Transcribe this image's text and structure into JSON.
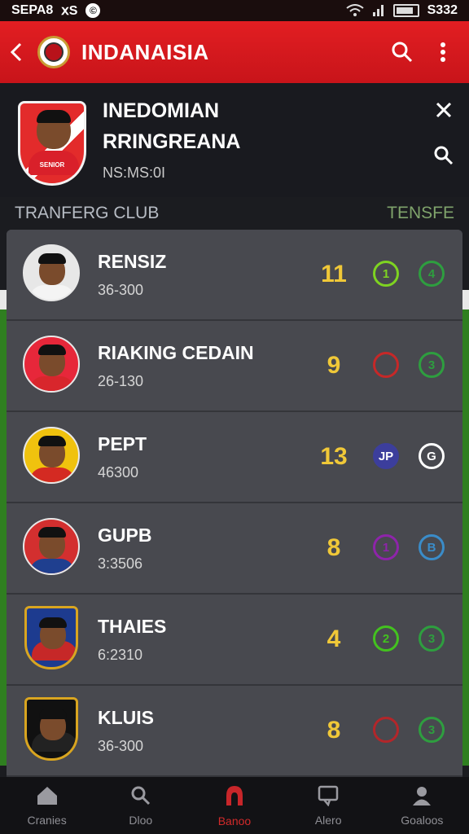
{
  "status_bar": {
    "left_text": "SEPA8",
    "left_glyph": "ⅹS",
    "right_text": "S332"
  },
  "app_bar": {
    "title": "INDANAISIA"
  },
  "profile": {
    "line1": "INEDOMIAN",
    "line2": "RRINGREANA",
    "meta": "NS:MS:0I",
    "badge_label": "SENIOR"
  },
  "section": {
    "left": "TRANFERG CLUB",
    "right": "TENSFE"
  },
  "rows": [
    {
      "name": "RENSIZ",
      "sub": "36-300",
      "score": "11",
      "pill_a": "1",
      "pill_b": "4",
      "pill_a_color": "#7ed321",
      "pill_b_color": "#2e9e3f",
      "avatar": "player",
      "shirt_color": "#f4f4f4",
      "bg_color": "#e7e7e7"
    },
    {
      "name": "RIAKING CEDAIN",
      "sub": "26-130",
      "score": "9",
      "pill_a": "",
      "pill_b": "3",
      "pill_a_color": "#c62828",
      "pill_b_color": "#2e9e3f",
      "avatar": "player",
      "shirt_color": "#d8262c",
      "bg_color": "#e7273a"
    },
    {
      "name": "PEPT",
      "sub": "46300",
      "score": "13",
      "pill_a": "JP",
      "pill_b": "G",
      "pill_a_color": "#3c3e9c",
      "pill_b_color": "#ffffff",
      "avatar": "player",
      "shirt_color": "#d42a22",
      "bg_color": "#f0c20e"
    },
    {
      "name": "GUPB",
      "sub": "3:3506",
      "score": "8",
      "pill_a": "1",
      "pill_b": "B",
      "pill_a_color": "#8e24aa",
      "pill_b_color": "#3a8cc9",
      "avatar": "player",
      "shirt_color": "#1f3f8f",
      "bg_color": "#d32f2f"
    },
    {
      "name": "THAIES",
      "sub": "6:2310",
      "score": "4",
      "pill_a": "2",
      "pill_b": "3",
      "pill_a_color": "#43c21f",
      "pill_b_color": "#2e9e3f",
      "avatar": "shield",
      "shirt_color": "#c62828",
      "bg_color": "#1d3b8f"
    },
    {
      "name": "KLUIS",
      "sub": "36-300",
      "score": "8",
      "pill_a": "",
      "pill_b": "3",
      "pill_a_color": "#b3262a",
      "pill_b_color": "#2e9e3f",
      "avatar": "shield",
      "shirt_color": "#222222",
      "bg_color": "#111111"
    }
  ],
  "bottom_nav": [
    {
      "label": "Cranies",
      "icon": "home-icon"
    },
    {
      "label": "Dloo",
      "icon": "search-icon"
    },
    {
      "label": "Banoo",
      "icon": "flame-icon"
    },
    {
      "label": "Alero",
      "icon": "chat-icon"
    },
    {
      "label": "Goaloos",
      "icon": "profile-icon"
    }
  ],
  "colors": {
    "accent": "#d9191f",
    "score": "#f0c838"
  }
}
